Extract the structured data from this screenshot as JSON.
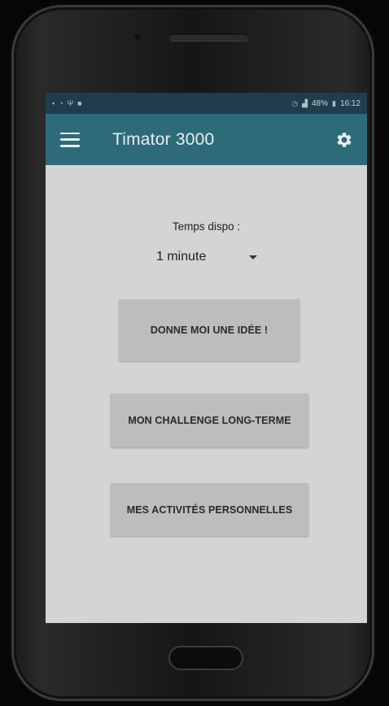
{
  "status_bar": {
    "left_icons": [
      "sim-icon",
      "wifi-icon",
      "usb-icon",
      "notification-icon"
    ],
    "battery": "48%",
    "time": "16:12"
  },
  "app_bar": {
    "title": "Timator 3000",
    "color": "#2e6b78"
  },
  "main": {
    "time_label": "Temps dispo :",
    "time_select": {
      "selected": "1 minute"
    },
    "buttons": {
      "idea": "DONNE MOI UNE IDÉE !",
      "challenge": "MON CHALLENGE LONG-TERME",
      "activities": "MES ACTIVITÉS PERSONNELLES"
    }
  }
}
